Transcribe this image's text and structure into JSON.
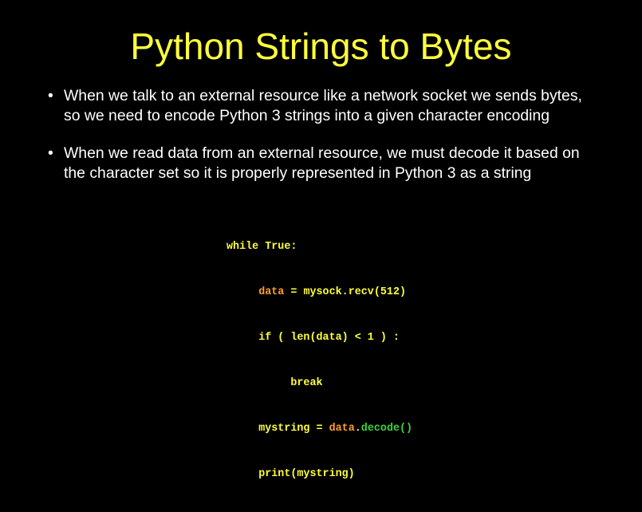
{
  "slide": {
    "title": "Python Strings to Bytes",
    "bullet_symbol": "•",
    "bullets": [
      {
        "line1": "When we talk to an external resource like a network socket we sends bytes,",
        "line2": "so we need to encode Python 3 strings into a given character encoding"
      },
      {
        "line1": "When we read data from an external resource, we must decode it based on",
        "line2": "the character set so it is properly represented in Python 3 as a string"
      }
    ],
    "code": {
      "l1": "while True:",
      "l2_var": "data",
      "l2_rest": " = mysock.recv(512)",
      "l3": "if ( len(data) < 1 ) :",
      "l4": "break",
      "l5_a": "mystring = ",
      "l5_var": "data",
      "l5_dot": ".",
      "l5_fn": "decode()",
      "l6": "print(mystring)"
    }
  },
  "colors": {
    "background": "#000000",
    "title": "#ffff3c",
    "text": "#ffffff",
    "code_default": "#ffff3c",
    "code_variable": "#ff9f2e",
    "code_method": "#3dd23d"
  }
}
